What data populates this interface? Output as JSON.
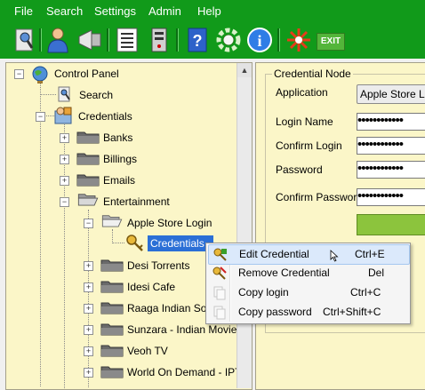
{
  "menu": {
    "file": "File",
    "search": "Search",
    "settings": "Settings",
    "admin": "Admin",
    "help": "Help"
  },
  "toolbar": {
    "exit_label": "EXIT"
  },
  "tree": {
    "root": "Control Panel",
    "search": "Search",
    "credentials": "Credentials",
    "banks": "Banks",
    "billings": "Billings",
    "emails": "Emails",
    "entertainment": "Entertainment",
    "apple_store_login": "Apple Store Login",
    "credential_leaf": "Credentials - ",
    "desi_torrents": "Desi Torrents",
    "idesi_cafe": "Idesi Cafe",
    "raaga": "Raaga Indian Song",
    "sunzara": "Sunzara - Indian Movies",
    "veoh": "Veoh TV",
    "world_on_demand": "World On Demand - IPTV"
  },
  "form": {
    "group_title": "Credential Node",
    "application_label": "Application",
    "application_value": "Apple Store Login",
    "login_name_label": "Login Name",
    "login_name_value": "••••••••••••",
    "confirm_login_label": "Confirm Login",
    "confirm_login_value": "••••••••••••",
    "password_label": "Password",
    "password_value": "••••••••••••",
    "confirm_password_label": "Confirm Password",
    "confirm_password_value": "••••••••••••"
  },
  "context_menu": {
    "edit": {
      "label": "Edit Credential",
      "shortcut": "Ctrl+E"
    },
    "remove": {
      "label": "Remove Credential",
      "shortcut": "Del"
    },
    "copy_login": {
      "label": "Copy login",
      "shortcut": "Ctrl+C"
    },
    "copy_password": {
      "label": "Copy password",
      "shortcut": "Ctrl+Shift+C"
    }
  }
}
